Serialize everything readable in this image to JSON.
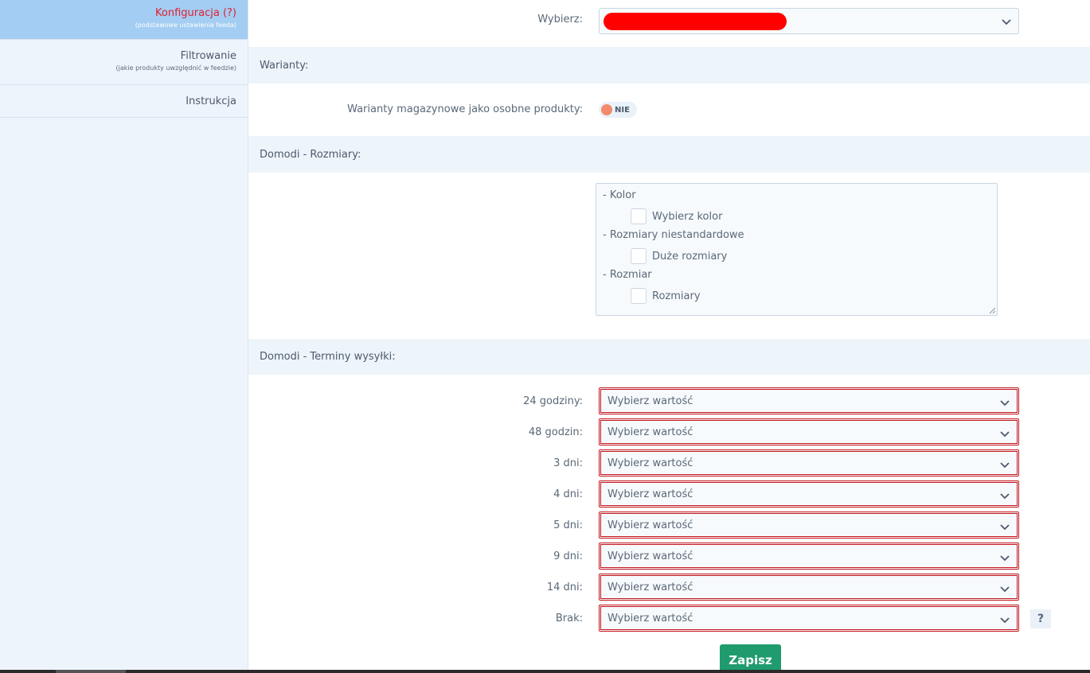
{
  "sidebar": {
    "items": [
      {
        "title": "Konfiguracja (?)",
        "subtitle": "(podstawowe ustawienia feeda)"
      },
      {
        "title": "Filtrowanie",
        "subtitle": "(jakie produkty uwzględnić w feedzie)"
      },
      {
        "title": "Instrukcja",
        "subtitle": ""
      }
    ]
  },
  "top": {
    "label": "Wybierz:"
  },
  "warianty": {
    "section_title": "Warianty:",
    "label": "Warianty magazynowe jako osobne produkty:",
    "toggle_value": "NIE"
  },
  "rozmiary": {
    "section_title": "Domodi - Rozmiary:",
    "groups": [
      {
        "name": "- Kolor",
        "option": "Wybierz kolor"
      },
      {
        "name": "- Rozmiary niestandardowe",
        "option": "Duże rozmiary"
      },
      {
        "name": "- Rozmiar",
        "option": "Rozmiary"
      }
    ]
  },
  "terminy": {
    "section_title": "Domodi - Terminy wysyłki:",
    "rows": [
      {
        "label": "24 godziny:",
        "value": "Wybierz wartość"
      },
      {
        "label": "48 godzin:",
        "value": "Wybierz wartość"
      },
      {
        "label": "3 dni:",
        "value": "Wybierz wartość"
      },
      {
        "label": "4 dni:",
        "value": "Wybierz wartość"
      },
      {
        "label": "5 dni:",
        "value": "Wybierz wartość"
      },
      {
        "label": "9 dni:",
        "value": "Wybierz wartość"
      },
      {
        "label": "14 dni:",
        "value": "Wybierz wartość"
      },
      {
        "label": "Brak:",
        "value": "Wybierz wartość"
      }
    ],
    "help": "?"
  },
  "actions": {
    "save_label": "Zapisz"
  },
  "colors": {
    "accent_red": "#e02030",
    "active_tab": "#a3cdf2",
    "save_green": "#1f9b6d",
    "error_border": "#c4141c"
  }
}
